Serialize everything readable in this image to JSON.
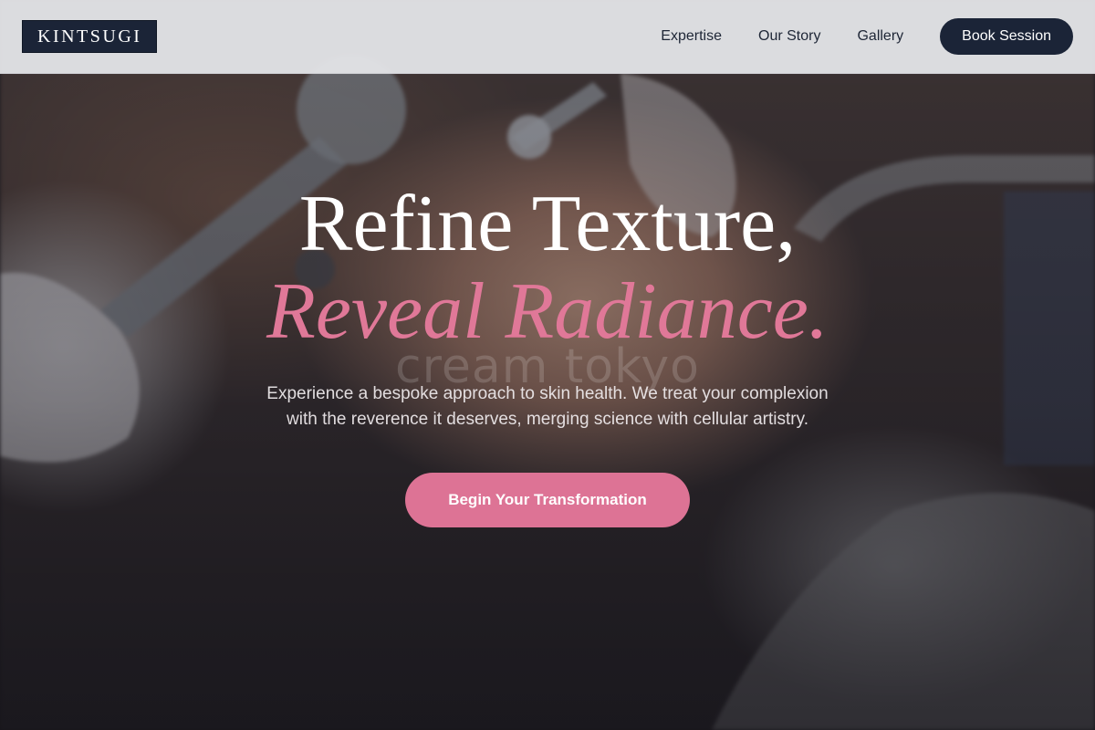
{
  "header": {
    "logo": "KINTSUGI",
    "nav": [
      "Expertise",
      "Our Story",
      "Gallery"
    ],
    "book_button": "Book Session"
  },
  "hero": {
    "headline_line1": "Refine Texture,",
    "headline_line2": "Reveal Radiance.",
    "watermark": "cream tokyo",
    "subtext": "Experience a bespoke approach to skin health. We treat your complexion with the reverence it deserves, merging science with cellular artistry.",
    "cta": "Begin Your Transformation"
  },
  "colors": {
    "navy": "#1b2437",
    "accent_pink": "#dd7395",
    "header_bg": "#e2e3e6"
  }
}
